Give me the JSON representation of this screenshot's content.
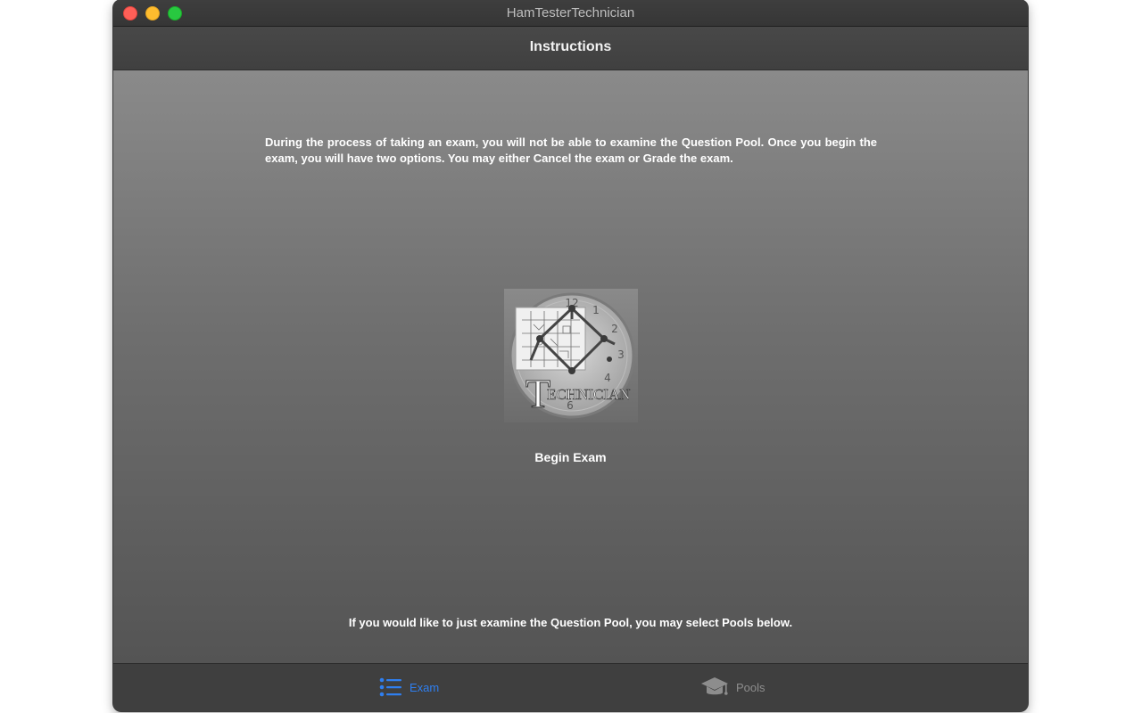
{
  "window": {
    "title": "HamTesterTechnician"
  },
  "nav": {
    "title": "Instructions"
  },
  "main": {
    "instructions": "During the process of taking an exam, you will not be able to examine the Question Pool. Once you begin the exam, you will have two options. You may either Cancel the exam or Grade the exam.",
    "exam_image_text": "TECHNICIAN",
    "begin_label": "Begin Exam",
    "bottom_note": "If you would like to just examine the Question Pool, you may select Pools below."
  },
  "tabs": [
    {
      "label": "Exam",
      "icon": "list-icon",
      "selected": true
    },
    {
      "label": "Pools",
      "icon": "graduation-cap-icon",
      "selected": false
    }
  ],
  "colors": {
    "accent": "#2f7ff0",
    "inactive_tab": "#8d8d8d"
  }
}
